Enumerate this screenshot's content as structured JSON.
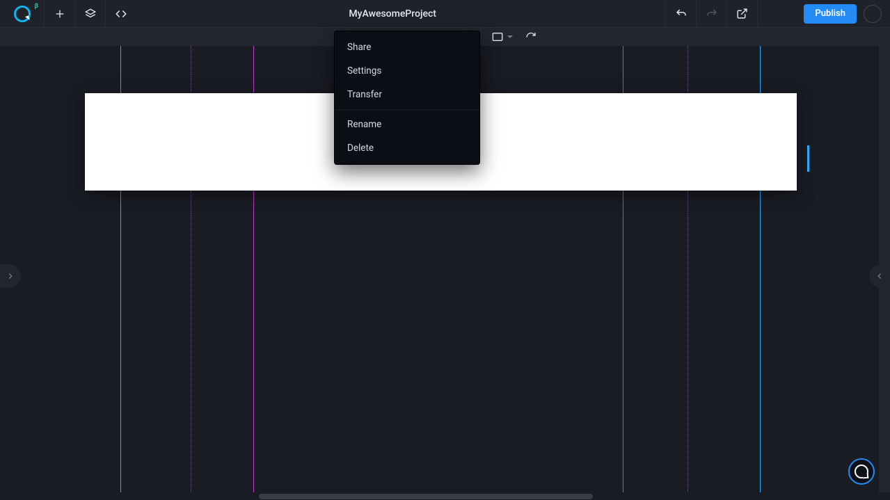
{
  "header": {
    "project_title": "MyAwesomeProject",
    "publish_label": "Publish",
    "logo_beta": "β"
  },
  "dropdown": {
    "items_a": [
      "Share",
      "Settings",
      "Transfer"
    ],
    "items_b": [
      "Rename",
      "Delete"
    ]
  }
}
